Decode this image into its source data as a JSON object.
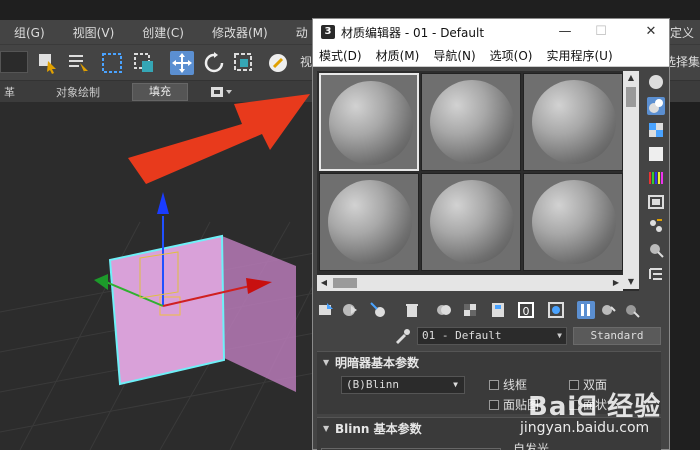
{
  "app": {
    "menu": [
      "组(G)",
      "视图(V)",
      "创建(C)",
      "修改器(M)",
      "动"
    ],
    "menu_right": "定义",
    "toolbar_right_label": "选择集",
    "toolbar_partial_label": "视",
    "ribbon": {
      "left_text": "革",
      "object_paint": "对象绘制",
      "fill_tab": "填充"
    }
  },
  "material_editor": {
    "title_icon": "3",
    "title": "材质编辑器 - 01 - Default",
    "window_buttons": {
      "minimize": "—",
      "maximize": "☐",
      "close": "✕"
    },
    "menu": [
      "模式(D)",
      "材质(M)",
      "导航(N)",
      "选项(O)",
      "实用程序(U)"
    ],
    "slot_count": 6,
    "material_name": "01 - Default",
    "material_type": "Standard",
    "rollouts": {
      "shader_basic": {
        "title": "明暗器基本参数",
        "shader": "(B)Blinn",
        "checkboxes": [
          "线框",
          "双面",
          "面贴图",
          "面状"
        ]
      },
      "blinn_basic": {
        "title": "Blinn 基本参数",
        "self_illumination": "自发光"
      }
    }
  },
  "watermark": {
    "logo": "Baiᗺ 经验",
    "url": "jingyan.baidu.com"
  },
  "colors": {
    "arrow": "#e83a1c",
    "accent_blue": "#5b8fd1",
    "plane_pink": "#d9a1d9"
  },
  "icons": [
    "select-icon",
    "move-icon",
    "rotate-icon",
    "scale-icon",
    "arrow-pointer-icon",
    "eyedropper-icon",
    "sphere-icon",
    "checker-icon"
  ]
}
